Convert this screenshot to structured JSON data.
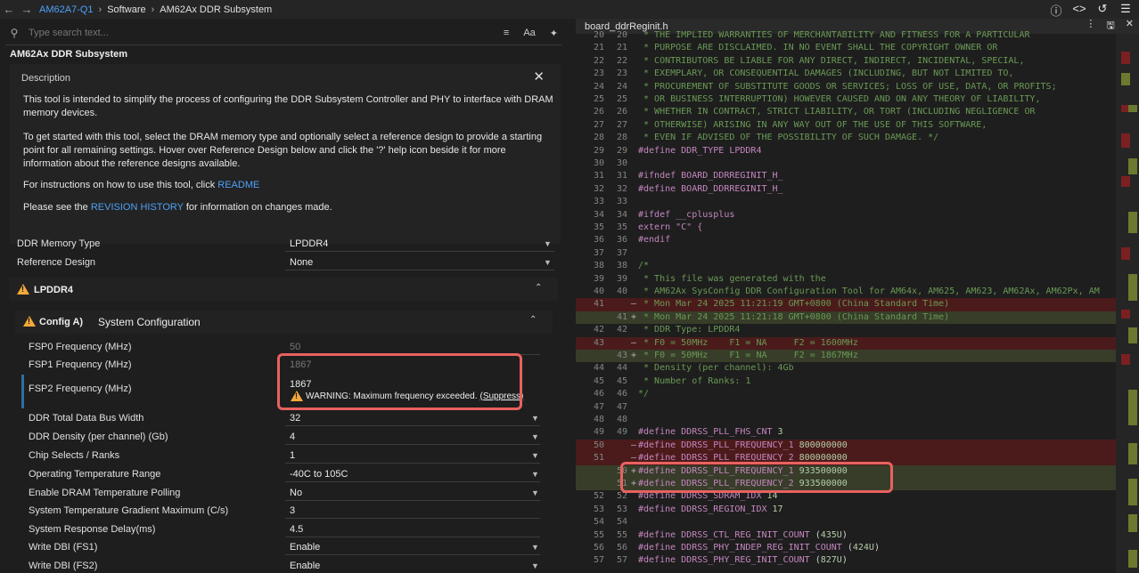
{
  "topbar": {
    "breadcrumb": [
      "AM62A7-Q1",
      "Software",
      "AM62Ax DDR Subsystem"
    ],
    "icons": [
      "info-icon",
      "code-icon",
      "history-icon",
      "settings-sliders-icon"
    ]
  },
  "left": {
    "search_placeholder": "Type search text...",
    "tool_title": "AM62Ax DDR Subsystem",
    "description": {
      "heading": "Description",
      "p1": "This tool is intended to simplify the process of configuring the DDR Subsystem Controller and PHY to interface with DRAM memory devices.",
      "p2": "To get started with this tool, select the DRAM memory type and optionally select a reference design to provide a starting point for all remaining settings. Hover over Reference Design below and click the '?' help icon beside it for more information about the reference designs available.",
      "p3_prefix": "For instructions on how to use this tool, click ",
      "p3_link": "README",
      "p4_prefix": "Please see the ",
      "p4_link": "REVISION HISTORY",
      "p4_suffix": " for information on changes made."
    },
    "top_fields": [
      {
        "label": "DDR Memory Type",
        "value": "LPDDR4"
      },
      {
        "label": "Reference Design",
        "value": "None"
      }
    ],
    "section_title": "LPDDR4",
    "subsection_prefix": "Config A)",
    "subsection_title": "System Configuration",
    "fsp0": {
      "label": "FSP0 Frequency (MHz)",
      "value": "50"
    },
    "fsp1": {
      "label": "FSP1 Frequency (MHz)",
      "value": "1867"
    },
    "fsp2": {
      "label": "FSP2 Frequency (MHz)",
      "value": "1867"
    },
    "warning_text": "WARNING: Maximum frequency exceeded.",
    "suppress": "(Suppress)",
    "fields": [
      {
        "label": "DDR Total Data Bus Width",
        "value": "32",
        "dropdown": true
      },
      {
        "label": "DDR Density (per channel) (Gb)",
        "value": "4",
        "dropdown": true
      },
      {
        "label": "Chip Selects / Ranks",
        "value": "1",
        "dropdown": true
      },
      {
        "label": "Operating Temperature Range",
        "value": "-40C to 105C",
        "dropdown": true
      },
      {
        "label": "Enable DRAM Temperature Polling",
        "value": "No",
        "dropdown": true
      },
      {
        "label": "System Temperature Gradient Maximum (C/s)",
        "value": "3",
        "dropdown": false
      },
      {
        "label": "System Response Delay(ms)",
        "value": "4.5",
        "dropdown": false
      },
      {
        "label": "Write DBI (FS1)",
        "value": "Enable",
        "dropdown": true
      },
      {
        "label": "Write DBI (FS2)",
        "value": "Enable",
        "dropdown": true
      }
    ]
  },
  "right": {
    "file_name": "board_ddrReginit.h",
    "lines": [
      {
        "a": "20",
        "b": "20",
        "m": "",
        "t": "c",
        "text": " * THE IMPLIED WARRANTIES OF MERCHANTABILITY AND FITNESS FOR A PARTICULAR"
      },
      {
        "a": "21",
        "b": "21",
        "m": "",
        "t": "c",
        "text": " * PURPOSE ARE DISCLAIMED. IN NO EVENT SHALL THE COPYRIGHT OWNER OR"
      },
      {
        "a": "22",
        "b": "22",
        "m": "",
        "t": "c",
        "text": " * CONTRIBUTORS BE LIABLE FOR ANY DIRECT, INDIRECT, INCIDENTAL, SPECIAL,"
      },
      {
        "a": "23",
        "b": "23",
        "m": "",
        "t": "c",
        "text": " * EXEMPLARY, OR CONSEQUENTIAL DAMAGES (INCLUDING, BUT NOT LIMITED TO,"
      },
      {
        "a": "24",
        "b": "24",
        "m": "",
        "t": "c",
        "text": " * PROCUREMENT OF SUBSTITUTE GOODS OR SERVICES; LOSS OF USE, DATA, OR PROFITS;"
      },
      {
        "a": "25",
        "b": "25",
        "m": "",
        "t": "c",
        "text": " * OR BUSINESS INTERRUPTION) HOWEVER CAUSED AND ON ANY THEORY OF LIABILITY,"
      },
      {
        "a": "26",
        "b": "26",
        "m": "",
        "t": "c",
        "text": " * WHETHER IN CONTRACT, STRICT LIABILITY, OR TORT (INCLUDING NEGLIGENCE OR"
      },
      {
        "a": "27",
        "b": "27",
        "m": "",
        "t": "c",
        "text": " * OTHERWISE) ARISING IN ANY WAY OUT OF THE USE OF THIS SOFTWARE,"
      },
      {
        "a": "28",
        "b": "28",
        "m": "",
        "t": "c",
        "text": " * EVEN IF ADVISED OF THE POSSIBILITY OF SUCH DAMAGE. */"
      },
      {
        "a": "29",
        "b": "29",
        "m": "",
        "t": "d",
        "text": "#define DDR_TYPE LPDDR4"
      },
      {
        "a": "30",
        "b": "30",
        "m": "",
        "t": "p",
        "text": ""
      },
      {
        "a": "31",
        "b": "31",
        "m": "",
        "t": "d",
        "text": "#ifndef BOARD_DDRREGINIT_H_"
      },
      {
        "a": "32",
        "b": "32",
        "m": "",
        "t": "d",
        "text": "#define BOARD_DDRREGINIT_H_"
      },
      {
        "a": "33",
        "b": "33",
        "m": "",
        "t": "p",
        "text": ""
      },
      {
        "a": "34",
        "b": "34",
        "m": "",
        "t": "d",
        "text": "#ifdef __cplusplus"
      },
      {
        "a": "35",
        "b": "35",
        "m": "",
        "t": "e",
        "text": "extern \"C\" {"
      },
      {
        "a": "36",
        "b": "36",
        "m": "",
        "t": "d",
        "text": "#endif"
      },
      {
        "a": "37",
        "b": "37",
        "m": "",
        "t": "p",
        "text": ""
      },
      {
        "a": "38",
        "b": "38",
        "m": "",
        "t": "c",
        "text": "/*"
      },
      {
        "a": "39",
        "b": "39",
        "m": "",
        "t": "c",
        "text": " * This file was generated with the"
      },
      {
        "a": "40",
        "b": "40",
        "m": "",
        "t": "c",
        "text": " * AM62Ax SysConfig DDR Configuration Tool for AM64x, AM625, AM623, AM62Ax, AM62Px, AM"
      },
      {
        "a": "41",
        "b": "",
        "m": "–",
        "t": "cdel",
        "text": " * Mon Mar 24 2025 11:21:19 GMT+0800 (China Standard Time)"
      },
      {
        "a": "",
        "b": "41",
        "m": "+",
        "t": "cadd",
        "text": " * Mon Mar 24 2025 11:21:18 GMT+0800 (China Standard Time)"
      },
      {
        "a": "42",
        "b": "42",
        "m": "",
        "t": "c",
        "text": " * DDR Type: LPDDR4"
      },
      {
        "a": "43",
        "b": "",
        "m": "–",
        "t": "cdel",
        "text": " * F0 = 50MHz    F1 = NA     F2 = 1600MHz"
      },
      {
        "a": "",
        "b": "43",
        "m": "+",
        "t": "cadd",
        "text": " * F0 = 50MHz    F1 = NA     F2 = 1867MHz"
      },
      {
        "a": "44",
        "b": "44",
        "m": "",
        "t": "c",
        "text": " * Density (per channel): 4Gb"
      },
      {
        "a": "45",
        "b": "45",
        "m": "",
        "t": "c",
        "text": " * Number of Ranks: 1"
      },
      {
        "a": "46",
        "b": "46",
        "m": "",
        "t": "c",
        "text": "*/"
      },
      {
        "a": "47",
        "b": "47",
        "m": "",
        "t": "p",
        "text": ""
      },
      {
        "a": "48",
        "b": "48",
        "m": "",
        "t": "p",
        "text": ""
      },
      {
        "a": "49",
        "b": "49",
        "m": "",
        "t": "dn",
        "text": "#define DDRSS_PLL_FHS_CNT ",
        "num": "3"
      },
      {
        "a": "50",
        "b": "",
        "m": "–",
        "t": "dndel",
        "text": "#define DDRSS_PLL_FREQUENCY_1 ",
        "num": "800000000"
      },
      {
        "a": "51",
        "b": "",
        "m": "–",
        "t": "dndel",
        "text": "#define DDRSS_PLL_FREQUENCY_2 ",
        "num": "800000000"
      },
      {
        "a": "",
        "b": "50",
        "m": "+",
        "t": "dnadd",
        "text": "#define DDRSS_PLL_FREQUENCY_1 ",
        "num": "933500000"
      },
      {
        "a": "",
        "b": "51",
        "m": "+",
        "t": "dnadd",
        "text": "#define DDRSS_PLL_FREQUENCY_2 ",
        "num": "933500000"
      },
      {
        "a": "52",
        "b": "52",
        "m": "",
        "t": "dn",
        "text": "#define DDRSS_SDRAM_IDX ",
        "num": "14"
      },
      {
        "a": "53",
        "b": "53",
        "m": "",
        "t": "dn",
        "text": "#define DDRSS_REGION_IDX ",
        "num": "17"
      },
      {
        "a": "54",
        "b": "54",
        "m": "",
        "t": "p",
        "text": ""
      },
      {
        "a": "55",
        "b": "55",
        "m": "",
        "t": "dp",
        "text": "#define DDRSS_CTL_REG_INIT_COUNT ",
        "num": "435U"
      },
      {
        "a": "56",
        "b": "56",
        "m": "",
        "t": "dp",
        "text": "#define DDRSS_PHY_INDEP_REG_INIT_COUNT ",
        "num": "424U"
      },
      {
        "a": "57",
        "b": "57",
        "m": "",
        "t": "dp",
        "text": "#define DDRSS_PHY_REG_INIT_COUNT ",
        "num": "827U"
      }
    ]
  }
}
